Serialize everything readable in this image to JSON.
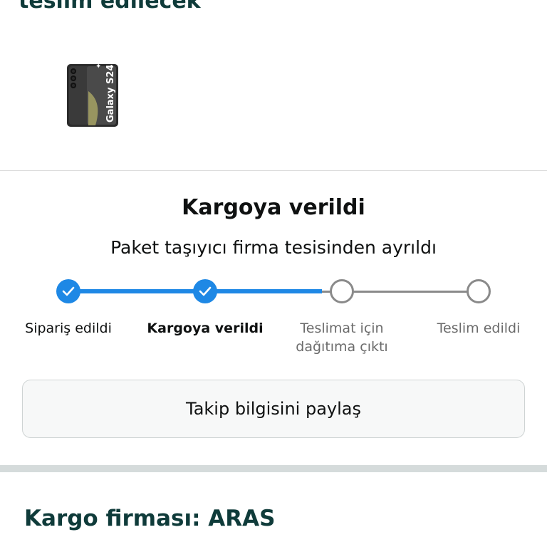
{
  "delivery": {
    "heading": "teslim edilecek"
  },
  "product": {
    "image_alt": "Galaxy S24",
    "device_label": "Galaxy S24"
  },
  "tracking": {
    "status_title": "Kargoya verildi",
    "status_subtitle": "Paket taşıyıcı firma tesisinden ayrıldı",
    "steps": [
      {
        "label": "Sipariş edildi",
        "completed": true,
        "current": false
      },
      {
        "label": "Kargoya verildi",
        "completed": true,
        "current": true
      },
      {
        "label": "Teslimat için dağıtıma çıktı",
        "completed": false,
        "current": false
      },
      {
        "label": "Teslim edildi",
        "completed": false,
        "current": false
      }
    ],
    "share_button_label": "Takip bilgisini paylaş"
  },
  "carrier": {
    "heading": "Kargo firması: ARAS"
  },
  "colors": {
    "accent": "#1e88e5",
    "heading": "#0f3b3a",
    "inactive": "#8a8a8a"
  }
}
